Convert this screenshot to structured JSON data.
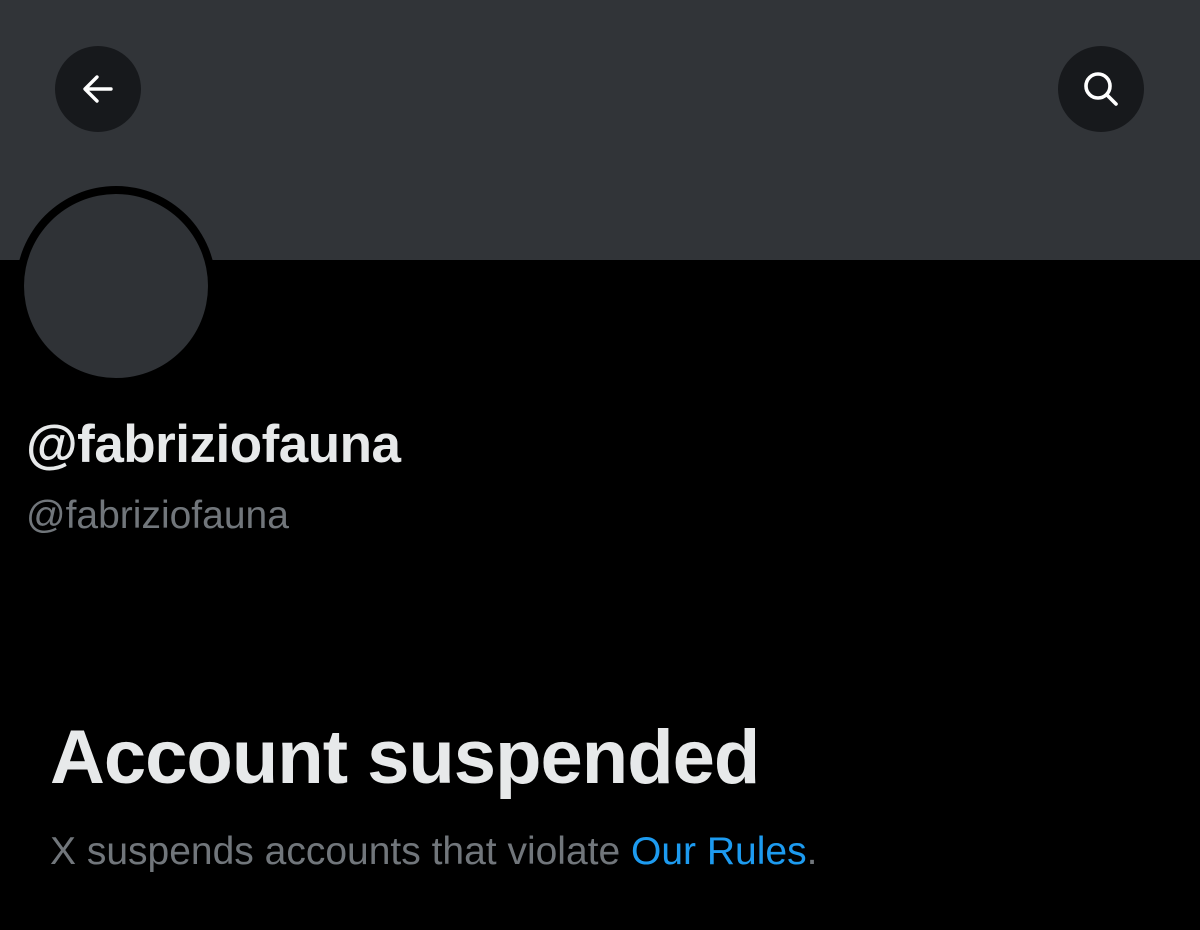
{
  "header": {
    "back_icon": "arrow-left-icon",
    "search_icon": "search-icon"
  },
  "profile": {
    "display_name": "@fabriziofauna",
    "handle": "@fabriziofauna"
  },
  "suspension": {
    "title": "Account suspended",
    "description_prefix": "X suspends accounts that violate ",
    "rules_link": "Our Rules",
    "description_suffix": "."
  },
  "colors": {
    "background": "#000000",
    "banner": "#313438",
    "nav_button": "#17191c",
    "primary_text": "#e7e9ea",
    "secondary_text": "#71767b",
    "link": "#1d9bf0"
  }
}
